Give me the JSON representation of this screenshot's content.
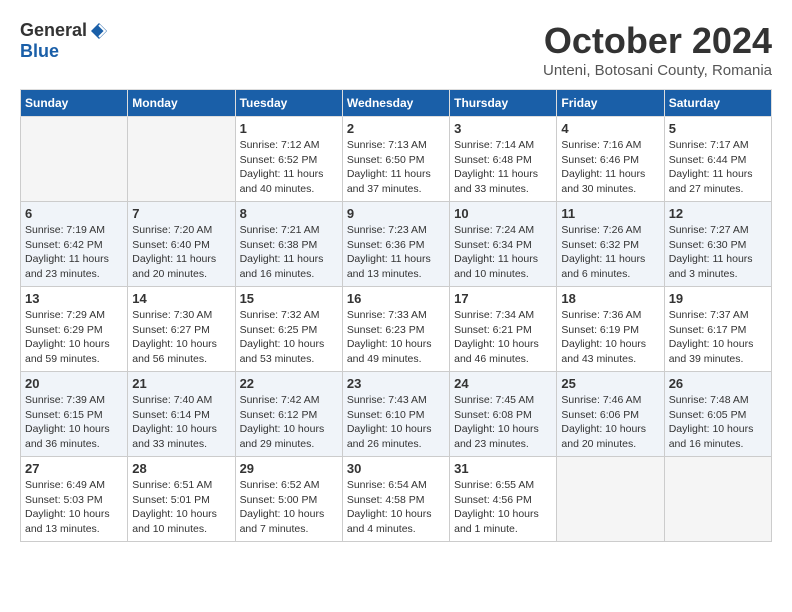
{
  "logo": {
    "general": "General",
    "blue": "Blue"
  },
  "title": "October 2024",
  "subtitle": "Unteni, Botosani County, Romania",
  "weekdays": [
    "Sunday",
    "Monday",
    "Tuesday",
    "Wednesday",
    "Thursday",
    "Friday",
    "Saturday"
  ],
  "weeks": [
    [
      {
        "day": "",
        "info": ""
      },
      {
        "day": "",
        "info": ""
      },
      {
        "day": "1",
        "info": "Sunrise: 7:12 AM\nSunset: 6:52 PM\nDaylight: 11 hours and 40 minutes."
      },
      {
        "day": "2",
        "info": "Sunrise: 7:13 AM\nSunset: 6:50 PM\nDaylight: 11 hours and 37 minutes."
      },
      {
        "day": "3",
        "info": "Sunrise: 7:14 AM\nSunset: 6:48 PM\nDaylight: 11 hours and 33 minutes."
      },
      {
        "day": "4",
        "info": "Sunrise: 7:16 AM\nSunset: 6:46 PM\nDaylight: 11 hours and 30 minutes."
      },
      {
        "day": "5",
        "info": "Sunrise: 7:17 AM\nSunset: 6:44 PM\nDaylight: 11 hours and 27 minutes."
      }
    ],
    [
      {
        "day": "6",
        "info": "Sunrise: 7:19 AM\nSunset: 6:42 PM\nDaylight: 11 hours and 23 minutes."
      },
      {
        "day": "7",
        "info": "Sunrise: 7:20 AM\nSunset: 6:40 PM\nDaylight: 11 hours and 20 minutes."
      },
      {
        "day": "8",
        "info": "Sunrise: 7:21 AM\nSunset: 6:38 PM\nDaylight: 11 hours and 16 minutes."
      },
      {
        "day": "9",
        "info": "Sunrise: 7:23 AM\nSunset: 6:36 PM\nDaylight: 11 hours and 13 minutes."
      },
      {
        "day": "10",
        "info": "Sunrise: 7:24 AM\nSunset: 6:34 PM\nDaylight: 11 hours and 10 minutes."
      },
      {
        "day": "11",
        "info": "Sunrise: 7:26 AM\nSunset: 6:32 PM\nDaylight: 11 hours and 6 minutes."
      },
      {
        "day": "12",
        "info": "Sunrise: 7:27 AM\nSunset: 6:30 PM\nDaylight: 11 hours and 3 minutes."
      }
    ],
    [
      {
        "day": "13",
        "info": "Sunrise: 7:29 AM\nSunset: 6:29 PM\nDaylight: 10 hours and 59 minutes."
      },
      {
        "day": "14",
        "info": "Sunrise: 7:30 AM\nSunset: 6:27 PM\nDaylight: 10 hours and 56 minutes."
      },
      {
        "day": "15",
        "info": "Sunrise: 7:32 AM\nSunset: 6:25 PM\nDaylight: 10 hours and 53 minutes."
      },
      {
        "day": "16",
        "info": "Sunrise: 7:33 AM\nSunset: 6:23 PM\nDaylight: 10 hours and 49 minutes."
      },
      {
        "day": "17",
        "info": "Sunrise: 7:34 AM\nSunset: 6:21 PM\nDaylight: 10 hours and 46 minutes."
      },
      {
        "day": "18",
        "info": "Sunrise: 7:36 AM\nSunset: 6:19 PM\nDaylight: 10 hours and 43 minutes."
      },
      {
        "day": "19",
        "info": "Sunrise: 7:37 AM\nSunset: 6:17 PM\nDaylight: 10 hours and 39 minutes."
      }
    ],
    [
      {
        "day": "20",
        "info": "Sunrise: 7:39 AM\nSunset: 6:15 PM\nDaylight: 10 hours and 36 minutes."
      },
      {
        "day": "21",
        "info": "Sunrise: 7:40 AM\nSunset: 6:14 PM\nDaylight: 10 hours and 33 minutes."
      },
      {
        "day": "22",
        "info": "Sunrise: 7:42 AM\nSunset: 6:12 PM\nDaylight: 10 hours and 29 minutes."
      },
      {
        "day": "23",
        "info": "Sunrise: 7:43 AM\nSunset: 6:10 PM\nDaylight: 10 hours and 26 minutes."
      },
      {
        "day": "24",
        "info": "Sunrise: 7:45 AM\nSunset: 6:08 PM\nDaylight: 10 hours and 23 minutes."
      },
      {
        "day": "25",
        "info": "Sunrise: 7:46 AM\nSunset: 6:06 PM\nDaylight: 10 hours and 20 minutes."
      },
      {
        "day": "26",
        "info": "Sunrise: 7:48 AM\nSunset: 6:05 PM\nDaylight: 10 hours and 16 minutes."
      }
    ],
    [
      {
        "day": "27",
        "info": "Sunrise: 6:49 AM\nSunset: 5:03 PM\nDaylight: 10 hours and 13 minutes."
      },
      {
        "day": "28",
        "info": "Sunrise: 6:51 AM\nSunset: 5:01 PM\nDaylight: 10 hours and 10 minutes."
      },
      {
        "day": "29",
        "info": "Sunrise: 6:52 AM\nSunset: 5:00 PM\nDaylight: 10 hours and 7 minutes."
      },
      {
        "day": "30",
        "info": "Sunrise: 6:54 AM\nSunset: 4:58 PM\nDaylight: 10 hours and 4 minutes."
      },
      {
        "day": "31",
        "info": "Sunrise: 6:55 AM\nSunset: 4:56 PM\nDaylight: 10 hours and 1 minute."
      },
      {
        "day": "",
        "info": ""
      },
      {
        "day": "",
        "info": ""
      }
    ]
  ]
}
